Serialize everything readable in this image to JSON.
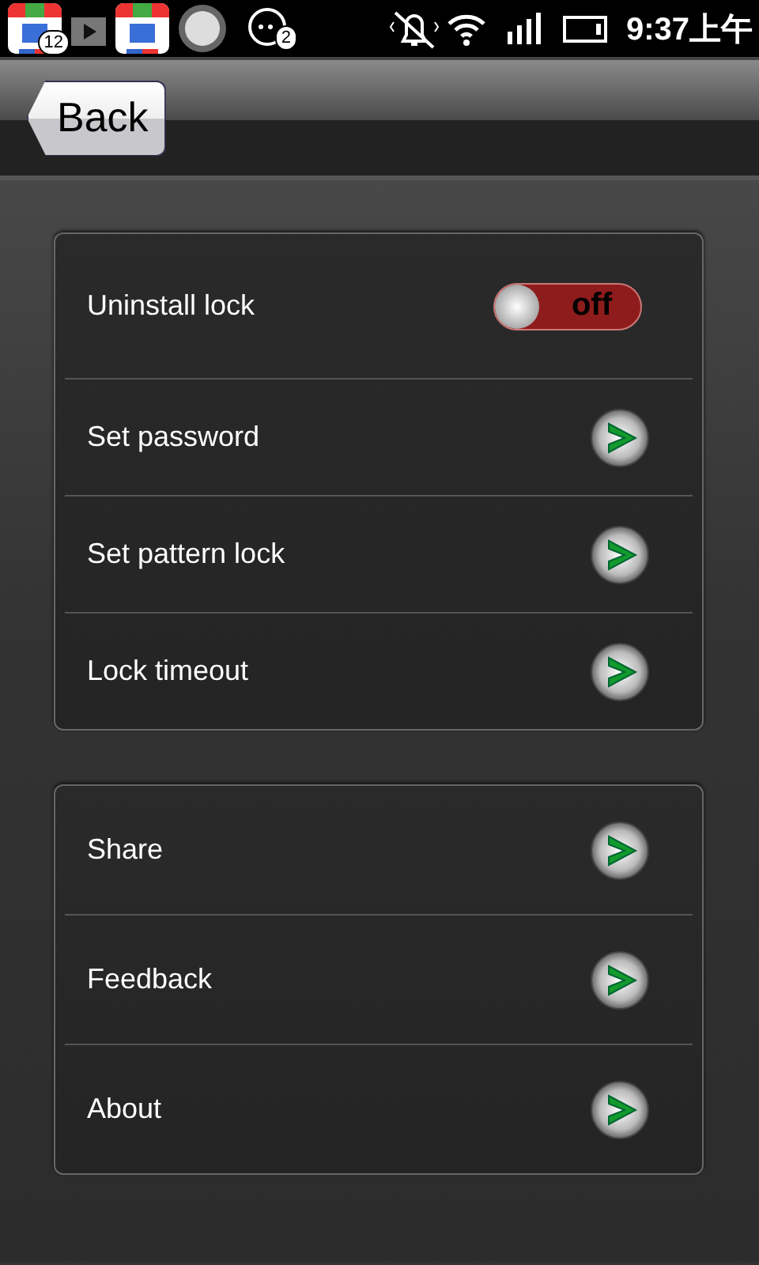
{
  "status_bar": {
    "notifications": [
      {
        "kind": "store",
        "badge": "12"
      },
      {
        "kind": "play"
      },
      {
        "kind": "store"
      },
      {
        "kind": "circle"
      },
      {
        "kind": "chat",
        "badge": "2"
      }
    ],
    "time": "9:37上午"
  },
  "header": {
    "back_button": "Back"
  },
  "groups": [
    {
      "items": [
        {
          "kind": "toggle",
          "label": "Uninstall lock",
          "on": false,
          "state_label": "off"
        },
        {
          "kind": "link",
          "label": "Set password"
        },
        {
          "kind": "link",
          "label": "Set pattern lock"
        },
        {
          "kind": "link",
          "label": "Lock timeout"
        }
      ]
    },
    {
      "items": [
        {
          "kind": "link",
          "label": "Share"
        },
        {
          "kind": "link",
          "label": "Feedback"
        },
        {
          "kind": "link",
          "label": "About"
        }
      ]
    }
  ]
}
